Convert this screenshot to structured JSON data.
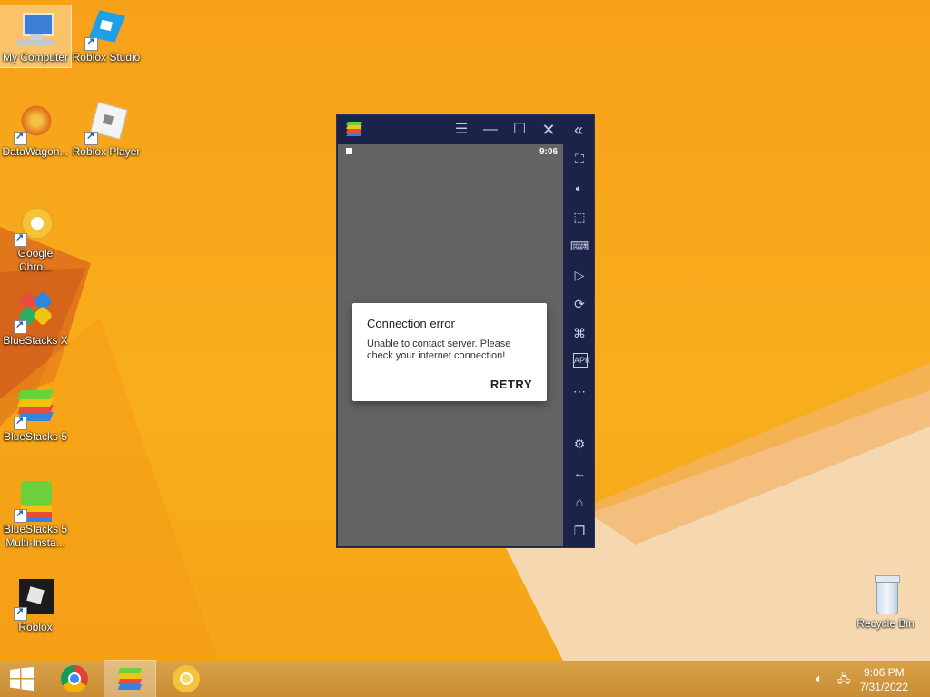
{
  "desktop": {
    "icons": [
      {
        "label": "My Computer"
      },
      {
        "label": "Roblox Studio"
      },
      {
        "label": "DataWagon..."
      },
      {
        "label": "Roblox Player"
      },
      {
        "label": "Google Chro..."
      },
      {
        "label": "BlueStacks X"
      },
      {
        "label": "BlueStacks 5"
      },
      {
        "label": "BlueStacks 5 Multi-Insta..."
      },
      {
        "label": "Roblox"
      },
      {
        "label": "Recycle Bin"
      }
    ]
  },
  "bluestacks": {
    "status_time": "9:06",
    "title_icons": [
      "menu-icon",
      "minimize-icon",
      "maximize-icon",
      "close-icon",
      "collapse-sidebar-icon"
    ],
    "sidebar_icons": [
      "fullscreen-icon",
      "volume-icon",
      "pointer-icon",
      "keyboard-icon",
      "macro-play-icon",
      "rotate-icon",
      "gamepad-icon",
      "apk-icon",
      "more-icon",
      "settings-icon",
      "back-icon",
      "home-icon",
      "recent-apps-icon"
    ]
  },
  "dialog": {
    "title": "Connection error",
    "message": "Unable to contact server. Please check your internet connection!",
    "retry_label": "RETRY"
  },
  "taskbar": {
    "time": "9:06 PM",
    "date": "7/31/2022"
  },
  "colors": {
    "desktop": "#f7a11a",
    "bluestacks_frame": "#1c2348",
    "emulator_screen": "#636363"
  }
}
